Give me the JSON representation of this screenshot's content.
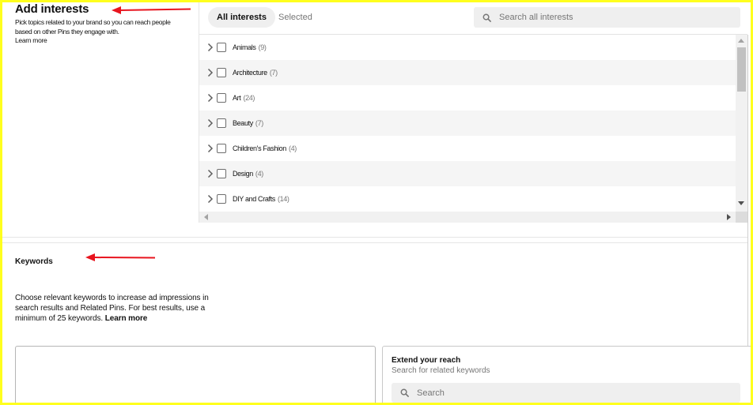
{
  "interests_section": {
    "title": "Add interests",
    "description": "Pick topics related to your brand so you can reach people based on other Pins they engage with.",
    "learn_more": "Learn more"
  },
  "tabs": [
    {
      "label": "All interests",
      "active": true
    },
    {
      "label": "Selected",
      "active": false
    }
  ],
  "interest_search": {
    "placeholder": "Search all interests"
  },
  "interests": [
    {
      "name": "Animals",
      "count": "(9)",
      "checked": false
    },
    {
      "name": "Architecture",
      "count": "(7)",
      "checked": false
    },
    {
      "name": "Art",
      "count": "(24)",
      "checked": false
    },
    {
      "name": "Beauty",
      "count": "(7)",
      "checked": false
    },
    {
      "name": "Children's Fashion",
      "count": "(4)",
      "checked": false
    },
    {
      "name": "Design",
      "count": "(4)",
      "checked": false
    },
    {
      "name": "DIY and Crafts",
      "count": "(14)",
      "checked": false
    }
  ],
  "keywords_section": {
    "title": "Keywords",
    "description": "Choose relevant keywords to increase ad impressions in search results and Related Pins. For best results, use a minimum of 25 keywords.",
    "learn_more": "Learn more",
    "textarea_value": ""
  },
  "extend_reach": {
    "title": "Extend your reach",
    "subtitle": "Search for related keywords",
    "search_placeholder": "Search"
  },
  "colors": {
    "annotation_border": "#ffff1e",
    "annotation_arrow": "#e8141e",
    "pill_background": "#efefef",
    "muted_text": "#767676"
  },
  "icons": {
    "arrows": "annotation-arrow-icon",
    "row_expand": "chevron-right-icon",
    "search": "search-icon"
  }
}
